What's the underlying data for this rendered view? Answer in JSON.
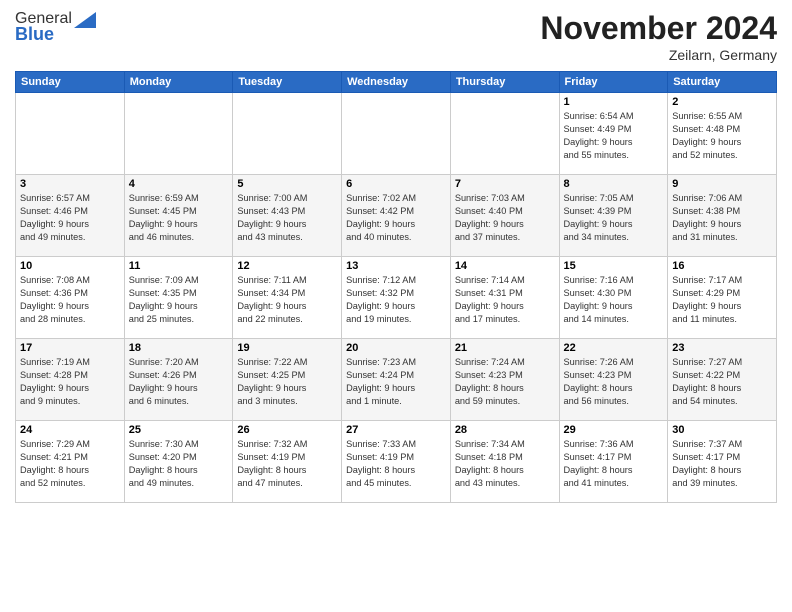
{
  "logo": {
    "general": "General",
    "blue": "Blue"
  },
  "header": {
    "title": "November 2024",
    "subtitle": "Zeilarn, Germany"
  },
  "weekdays": [
    "Sunday",
    "Monday",
    "Tuesday",
    "Wednesday",
    "Thursday",
    "Friday",
    "Saturday"
  ],
  "weeks": [
    [
      {
        "day": "",
        "info": ""
      },
      {
        "day": "",
        "info": ""
      },
      {
        "day": "",
        "info": ""
      },
      {
        "day": "",
        "info": ""
      },
      {
        "day": "",
        "info": ""
      },
      {
        "day": "1",
        "info": "Sunrise: 6:54 AM\nSunset: 4:49 PM\nDaylight: 9 hours\nand 55 minutes."
      },
      {
        "day": "2",
        "info": "Sunrise: 6:55 AM\nSunset: 4:48 PM\nDaylight: 9 hours\nand 52 minutes."
      }
    ],
    [
      {
        "day": "3",
        "info": "Sunrise: 6:57 AM\nSunset: 4:46 PM\nDaylight: 9 hours\nand 49 minutes."
      },
      {
        "day": "4",
        "info": "Sunrise: 6:59 AM\nSunset: 4:45 PM\nDaylight: 9 hours\nand 46 minutes."
      },
      {
        "day": "5",
        "info": "Sunrise: 7:00 AM\nSunset: 4:43 PM\nDaylight: 9 hours\nand 43 minutes."
      },
      {
        "day": "6",
        "info": "Sunrise: 7:02 AM\nSunset: 4:42 PM\nDaylight: 9 hours\nand 40 minutes."
      },
      {
        "day": "7",
        "info": "Sunrise: 7:03 AM\nSunset: 4:40 PM\nDaylight: 9 hours\nand 37 minutes."
      },
      {
        "day": "8",
        "info": "Sunrise: 7:05 AM\nSunset: 4:39 PM\nDaylight: 9 hours\nand 34 minutes."
      },
      {
        "day": "9",
        "info": "Sunrise: 7:06 AM\nSunset: 4:38 PM\nDaylight: 9 hours\nand 31 minutes."
      }
    ],
    [
      {
        "day": "10",
        "info": "Sunrise: 7:08 AM\nSunset: 4:36 PM\nDaylight: 9 hours\nand 28 minutes."
      },
      {
        "day": "11",
        "info": "Sunrise: 7:09 AM\nSunset: 4:35 PM\nDaylight: 9 hours\nand 25 minutes."
      },
      {
        "day": "12",
        "info": "Sunrise: 7:11 AM\nSunset: 4:34 PM\nDaylight: 9 hours\nand 22 minutes."
      },
      {
        "day": "13",
        "info": "Sunrise: 7:12 AM\nSunset: 4:32 PM\nDaylight: 9 hours\nand 19 minutes."
      },
      {
        "day": "14",
        "info": "Sunrise: 7:14 AM\nSunset: 4:31 PM\nDaylight: 9 hours\nand 17 minutes."
      },
      {
        "day": "15",
        "info": "Sunrise: 7:16 AM\nSunset: 4:30 PM\nDaylight: 9 hours\nand 14 minutes."
      },
      {
        "day": "16",
        "info": "Sunrise: 7:17 AM\nSunset: 4:29 PM\nDaylight: 9 hours\nand 11 minutes."
      }
    ],
    [
      {
        "day": "17",
        "info": "Sunrise: 7:19 AM\nSunset: 4:28 PM\nDaylight: 9 hours\nand 9 minutes."
      },
      {
        "day": "18",
        "info": "Sunrise: 7:20 AM\nSunset: 4:26 PM\nDaylight: 9 hours\nand 6 minutes."
      },
      {
        "day": "19",
        "info": "Sunrise: 7:22 AM\nSunset: 4:25 PM\nDaylight: 9 hours\nand 3 minutes."
      },
      {
        "day": "20",
        "info": "Sunrise: 7:23 AM\nSunset: 4:24 PM\nDaylight: 9 hours\nand 1 minute."
      },
      {
        "day": "21",
        "info": "Sunrise: 7:24 AM\nSunset: 4:23 PM\nDaylight: 8 hours\nand 59 minutes."
      },
      {
        "day": "22",
        "info": "Sunrise: 7:26 AM\nSunset: 4:23 PM\nDaylight: 8 hours\nand 56 minutes."
      },
      {
        "day": "23",
        "info": "Sunrise: 7:27 AM\nSunset: 4:22 PM\nDaylight: 8 hours\nand 54 minutes."
      }
    ],
    [
      {
        "day": "24",
        "info": "Sunrise: 7:29 AM\nSunset: 4:21 PM\nDaylight: 8 hours\nand 52 minutes."
      },
      {
        "day": "25",
        "info": "Sunrise: 7:30 AM\nSunset: 4:20 PM\nDaylight: 8 hours\nand 49 minutes."
      },
      {
        "day": "26",
        "info": "Sunrise: 7:32 AM\nSunset: 4:19 PM\nDaylight: 8 hours\nand 47 minutes."
      },
      {
        "day": "27",
        "info": "Sunrise: 7:33 AM\nSunset: 4:19 PM\nDaylight: 8 hours\nand 45 minutes."
      },
      {
        "day": "28",
        "info": "Sunrise: 7:34 AM\nSunset: 4:18 PM\nDaylight: 8 hours\nand 43 minutes."
      },
      {
        "day": "29",
        "info": "Sunrise: 7:36 AM\nSunset: 4:17 PM\nDaylight: 8 hours\nand 41 minutes."
      },
      {
        "day": "30",
        "info": "Sunrise: 7:37 AM\nSunset: 4:17 PM\nDaylight: 8 hours\nand 39 minutes."
      }
    ]
  ]
}
